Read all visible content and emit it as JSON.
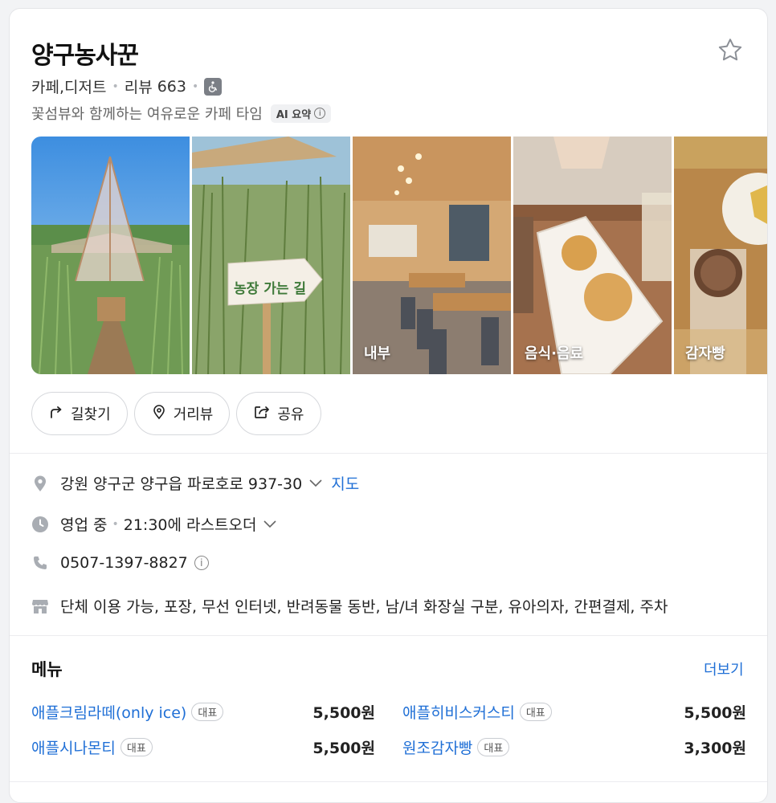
{
  "place": {
    "name": "양구농사꾼",
    "category": "카페,디저트",
    "review_label": "리뷰",
    "review_count": "663",
    "summary": "꽃섬뷰와 함께하는 여유로운 카페 타임",
    "ai_badge": "AI 요약",
    "ai_info": "i"
  },
  "photos": [
    {
      "caption": ""
    },
    {
      "caption": "",
      "sign_text": "농장 가는 길"
    },
    {
      "caption": "내부"
    },
    {
      "caption": "음식·음료"
    },
    {
      "caption": "감자빵"
    }
  ],
  "actions": {
    "directions": "길찾기",
    "street_view": "거리뷰",
    "share": "공유"
  },
  "info": {
    "address": "강원 양구군 양구읍 파로호로 937-30",
    "map_link": "지도",
    "status": "영업 중",
    "hours": "21:30에 라스트오더",
    "phone": "0507-1397-8827",
    "phone_info": "i",
    "amenities": "단체 이용 가능, 포장, 무선 인터넷, 반려동물 동반, 남/녀 화장실 구분, 유아의자, 간편결제, 주차"
  },
  "menu": {
    "title": "메뉴",
    "more": "더보기",
    "items": [
      {
        "name": "애플크림라떼(only ice)",
        "tag": "대표",
        "price": "5,500원"
      },
      {
        "name": "애플히비스커스티",
        "tag": "대표",
        "price": "5,500원"
      },
      {
        "name": "애플시나몬티",
        "tag": "대표",
        "price": "5,500원"
      },
      {
        "name": "원조감자빵",
        "tag": "대표",
        "price": "3,300원"
      }
    ]
  },
  "colors": {
    "accent": "#1f6fd6",
    "icon_gray": "#8a8e95"
  }
}
